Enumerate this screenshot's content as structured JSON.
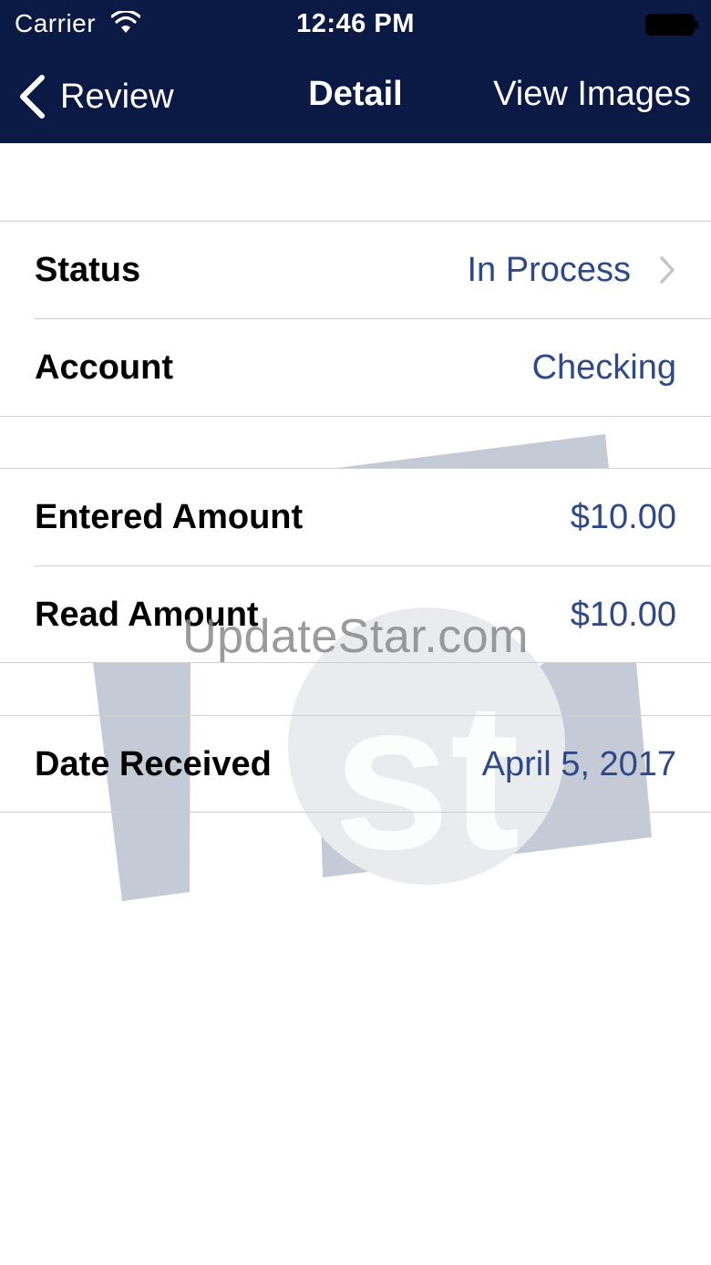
{
  "status_bar": {
    "carrier": "Carrier",
    "time": "12:46 PM",
    "wifi_icon": "wifi-icon",
    "battery_icon": "battery-icon"
  },
  "nav": {
    "back_label": "Review",
    "back_icon": "chevron-left-icon",
    "title": "Detail",
    "action_label": "View Images"
  },
  "groups": [
    {
      "rows": [
        {
          "label": "Status",
          "value": "In Process",
          "disclosure": true
        },
        {
          "label": "Account",
          "value": "Checking",
          "disclosure": false
        }
      ]
    },
    {
      "rows": [
        {
          "label": "Entered Amount",
          "value": "$10.00",
          "disclosure": false
        },
        {
          "label": "Read Amount",
          "value": "$10.00",
          "disclosure": false
        }
      ]
    },
    {
      "rows": [
        {
          "label": "Date Received",
          "value": "April 5, 2017",
          "disclosure": false
        }
      ]
    }
  ],
  "watermark": {
    "text": "UpdateStar.com"
  },
  "colors": {
    "header_bg": "#0b1a45",
    "value_text": "#2e4a86",
    "separator": "#cfcfd3",
    "watermark_shape": "#c4cad6"
  }
}
